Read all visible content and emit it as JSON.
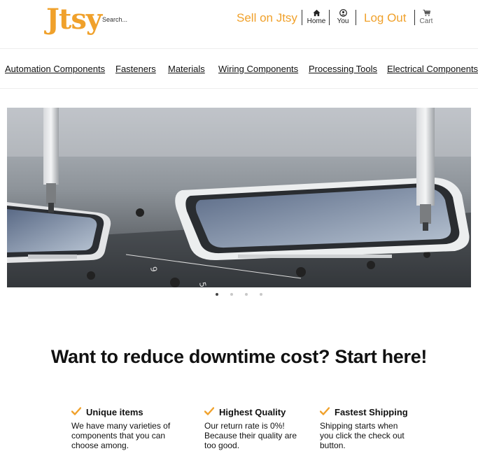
{
  "header": {
    "logo": "Jtsy",
    "search_placeholder": "Search...",
    "sell_label": "Sell on Jtsy",
    "home_label": "Home",
    "home_icon": "home-icon",
    "you_label": "You",
    "you_icon": "user-icon",
    "logout_label": "Log Out",
    "cart_label": "Cart",
    "cart_icon": "cart-icon",
    "accent_color": "#f0a12b"
  },
  "categories": [
    "Automation Components",
    "Fasteners",
    "Materials",
    "Wiring Components",
    "Processing Tools",
    "Electrical Components"
  ],
  "carousel": {
    "slide_count": 4,
    "active_index": 0
  },
  "headline": "Want to reduce downtime cost? Start here!",
  "features": [
    {
      "title": "Unique items",
      "description": "We have many varieties of components that you can choose among.",
      "icon": "check-icon"
    },
    {
      "title": "Highest Quality",
      "description": "Our return rate is 0%! Because their quality are too good.",
      "icon": "check-icon"
    },
    {
      "title": "Fastest Shipping",
      "description": "Shipping starts when you click the check out button.",
      "icon": "check-icon"
    }
  ]
}
